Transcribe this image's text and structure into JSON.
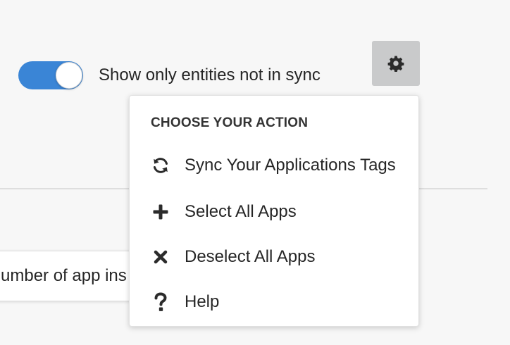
{
  "filter": {
    "toggle_state": "on",
    "toggle_color": "#3a85d6",
    "label": "Show only entities not in sync"
  },
  "settings_button": {
    "icon": "gear-icon",
    "background": "#c9cacb"
  },
  "partial_input": {
    "value": "umber of app ins"
  },
  "menu": {
    "header": "CHOOSE YOUR ACTION",
    "items": [
      {
        "icon": "sync-icon",
        "label": "Sync Your Applications Tags"
      },
      {
        "icon": "plus-icon",
        "label": "Select All Apps"
      },
      {
        "icon": "close-icon",
        "label": "Deselect All Apps"
      },
      {
        "icon": "question-icon",
        "label": "Help"
      }
    ]
  }
}
